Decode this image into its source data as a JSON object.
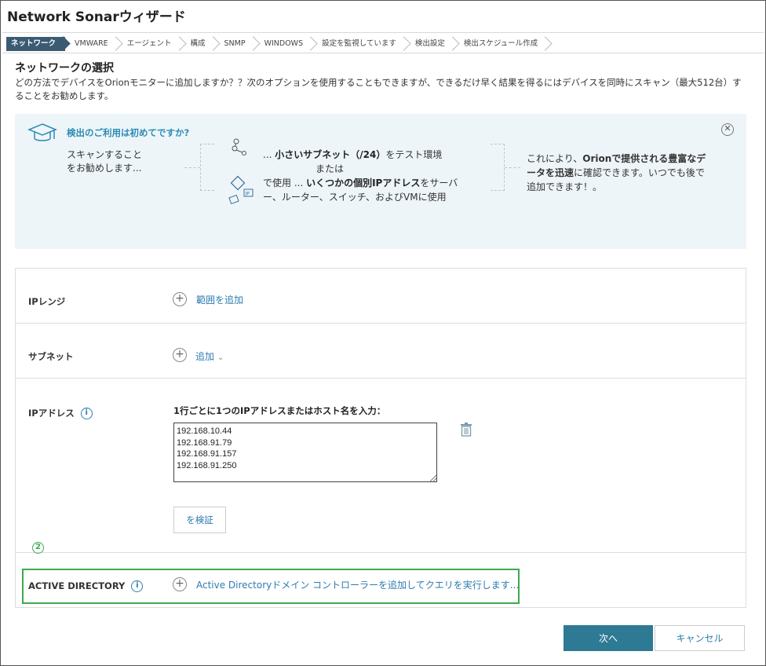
{
  "window": {
    "title": "Network Sonarウィザード"
  },
  "steps": [
    "ネットワーク",
    "VMWARE",
    "エージェント",
    "構成",
    "SNMP",
    "WINDOWS",
    "設定を監視しています",
    "検出設定",
    "検出スケジュール作成"
  ],
  "section": {
    "title": "ネットワークの選択",
    "intro": "どの方法でデバイスをOrionモニターに追加しますか？？次のオプションを使用することもできますが、できるだけ早く結果を得るにはデバイスを同時にスキャン（最大512台）することをお勧めします。"
  },
  "info_panel": {
    "title": "検出のご利用は初めてですか?",
    "left_line1": "スキャンすること",
    "left_line2": "をお勧めします...",
    "mid_line1_pre": "... ",
    "mid_line1_bold": "小さいサブネット（/24）",
    "mid_line1_post": "をテスト環境",
    "mid_or": "または",
    "mid_line3_pre": "で使用 ... ",
    "mid_line3_bold": "いくつかの個別IPアドレス",
    "mid_line3_post": "をサーバ",
    "mid_line4": "ー、ルーター、スイッチ、およびVMに使用",
    "right_pre": "これにより、",
    "right_bold": "Orionで提供される豊富なデータを迅速",
    "right_post": "に確認できます。いつでも後で追加できます！。",
    "close_symbol": "✕"
  },
  "form": {
    "ip_range": {
      "label": "IPレンジ",
      "add_label": "範囲を追加"
    },
    "subnet": {
      "label": "サブネット",
      "add_label": "追加",
      "dropdown": "⌄"
    },
    "ip_address": {
      "label": "IPアドレス",
      "hint": "1行ごとに1つのIPアドレスまたはホスト名を入力：",
      "values": [
        "192.168.10.44",
        "192.168.91.79",
        "192.168.91.157",
        "192.168.91.250"
      ],
      "verify_label": "を検証"
    },
    "active_directory": {
      "label": "ACTIVE DIRECTORY",
      "add_label": "Active Directoryドメイン コントローラーを追加してクエリを実行します..."
    }
  },
  "annotation": {
    "marker": "2",
    "color": "#3aab4f"
  },
  "footer": {
    "next_label": "次へ",
    "cancel_label": "キャンセル"
  },
  "colors": {
    "accent": "#2e7a94",
    "link": "#2e7cb0",
    "active_step": "#3b5b73",
    "panel_bg": "#eef5f8"
  }
}
